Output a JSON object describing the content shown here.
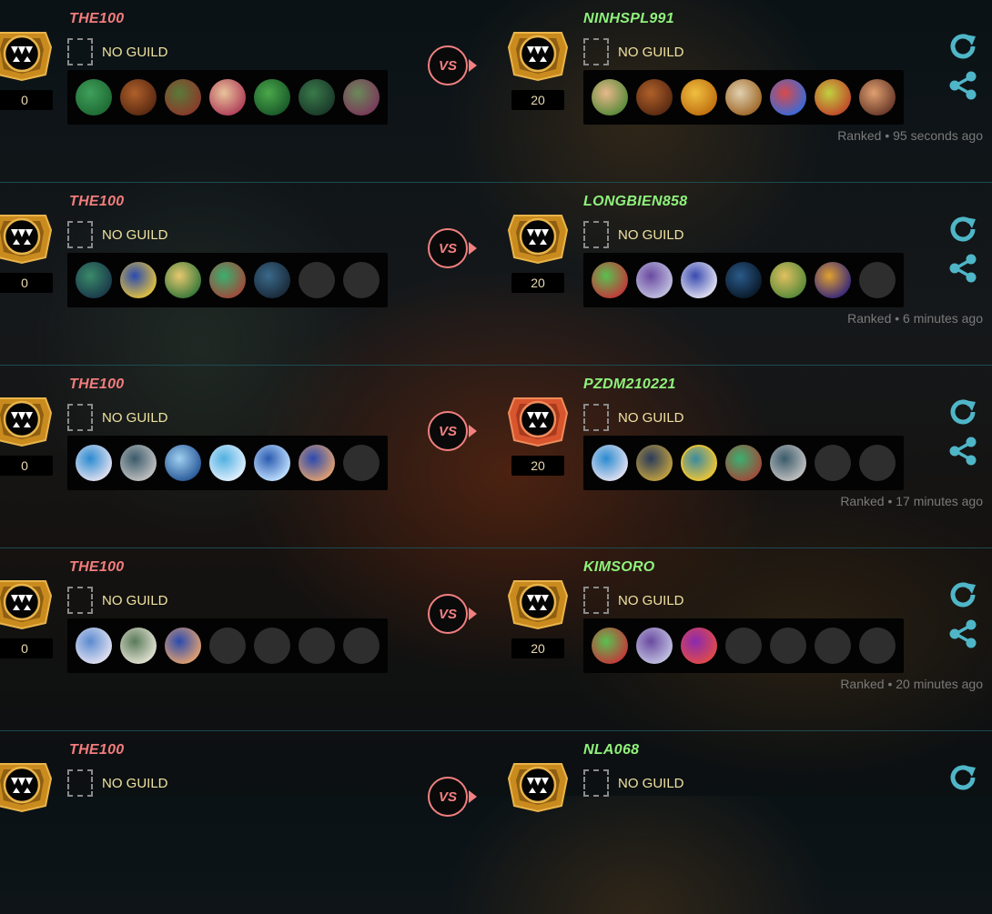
{
  "battles": [
    {
      "player1": {
        "name": "THE100",
        "guild": "NO GUILD",
        "rating": "0",
        "badge": "gold",
        "heroes": [
          [
            "#3fa05a",
            "#1f6a34"
          ],
          [
            "#b0602a",
            "#5a2a12"
          ],
          [
            "#5a7a3a",
            "#8a3a2a"
          ],
          [
            "#e8c49a",
            "#b0405a"
          ],
          [
            "#4aa84a",
            "#1a5a2a"
          ],
          [
            "#3a7a4a",
            "#1a3a2a"
          ],
          [
            "#6a8a5a",
            "#7a3a5a"
          ]
        ]
      },
      "player2": {
        "name": "NINHSPL991",
        "guild": "NO GUILD",
        "rating": "20",
        "badge": "gold",
        "heroes": [
          [
            "#e8b88a",
            "#5a8a3a"
          ],
          [
            "#b0602a",
            "#5a2a12"
          ],
          [
            "#f0c040",
            "#c07010"
          ],
          [
            "#e0d0b0",
            "#a06a2a"
          ],
          [
            "#d84a4a",
            "#3a6ad8"
          ],
          [
            "#c0d040",
            "#c04a2a"
          ],
          [
            "#e0a070",
            "#6a3a2a"
          ]
        ]
      },
      "mode": "Ranked",
      "time": "95 seconds ago"
    },
    {
      "player1": {
        "name": "THE100",
        "guild": "NO GUILD",
        "rating": "0",
        "badge": "gold",
        "heroes": [
          [
            "#3a8a6a",
            "#1a3a4a"
          ],
          [
            "#2a4ab0",
            "#e0c040"
          ],
          [
            "#e8c870",
            "#3a7a3a"
          ],
          [
            "#3ab070",
            "#a04a3a"
          ],
          [
            "#3a6a8a",
            "#1a2a3a"
          ],
          null,
          null
        ]
      },
      "player2": {
        "name": "LONGBIEN858",
        "guild": "NO GUILD",
        "rating": "20",
        "badge": "gold",
        "heroes": [
          [
            "#5ac050",
            "#c03a3a"
          ],
          [
            "#6a4aa0",
            "#c0c0e0"
          ],
          [
            "#3a4ab0",
            "#e0e0f0"
          ],
          [
            "#2a5a8a",
            "#0a1a2a"
          ],
          [
            "#e0c060",
            "#5a8a3a"
          ],
          [
            "#e0a030",
            "#3a2a7a"
          ],
          null
        ]
      },
      "mode": "Ranked",
      "time": "6 minutes ago"
    },
    {
      "player1": {
        "name": "THE100",
        "guild": "NO GUILD",
        "rating": "0",
        "badge": "gold",
        "heroes": [
          [
            "#2a8ad0",
            "#e0e0f0"
          ],
          [
            "#3a5a6a",
            "#c0c0c0"
          ],
          [
            "#a0d0f0",
            "#2a5a9a"
          ],
          [
            "#50b0e0",
            "#e0f0ff"
          ],
          [
            "#2a5ab0",
            "#c0e0ff"
          ],
          [
            "#2a4ab0",
            "#e0a070"
          ],
          null
        ]
      },
      "player2": {
        "name": "PZDM210221",
        "guild": "NO GUILD",
        "rating": "20",
        "badge": "red",
        "heroes": [
          [
            "#2a8ad0",
            "#e0e0f0"
          ],
          [
            "#2a3a5a",
            "#c0a040"
          ],
          [
            "#3a8aa0",
            "#e0c040"
          ],
          [
            "#3ab070",
            "#a04a3a"
          ],
          [
            "#3a5a6a",
            "#c0c0c0"
          ],
          null,
          null
        ],
        "selected_index": 2
      },
      "mode": "Ranked",
      "time": "17 minutes ago"
    },
    {
      "player1": {
        "name": "THE100",
        "guild": "NO GUILD",
        "rating": "0",
        "badge": "gold",
        "heroes": [
          [
            "#5a8ad0",
            "#e0e0f0"
          ],
          [
            "#5a7a5a",
            "#e0e0d0"
          ],
          [
            "#2a4ab0",
            "#e0a070"
          ],
          null,
          null,
          null,
          null
        ]
      },
      "player2": {
        "name": "KIMSORO",
        "guild": "NO GUILD",
        "rating": "20",
        "badge": "gold",
        "heroes": [
          [
            "#5ac050",
            "#c03a3a"
          ],
          [
            "#6a4aa0",
            "#c0c0e0"
          ],
          [
            "#8a2ab0",
            "#e04a4a"
          ],
          null,
          null,
          null,
          null
        ]
      },
      "mode": "Ranked",
      "time": "20 minutes ago"
    },
    {
      "player1": {
        "name": "THE100",
        "guild": "NO GUILD",
        "badge": "gold"
      },
      "player2": {
        "name": "NLA068",
        "guild": "NO GUILD",
        "badge": "gold"
      }
    }
  ],
  "vs_label": "VS",
  "separator": " • ",
  "icons": {
    "replay": "replay-icon",
    "share": "share-icon",
    "guild": "guild-banner-icon"
  },
  "colors": {
    "player1": "#f27c7c",
    "player2": "#8ff27c",
    "accent": "#4fb6c8",
    "vs": "#f28080"
  }
}
